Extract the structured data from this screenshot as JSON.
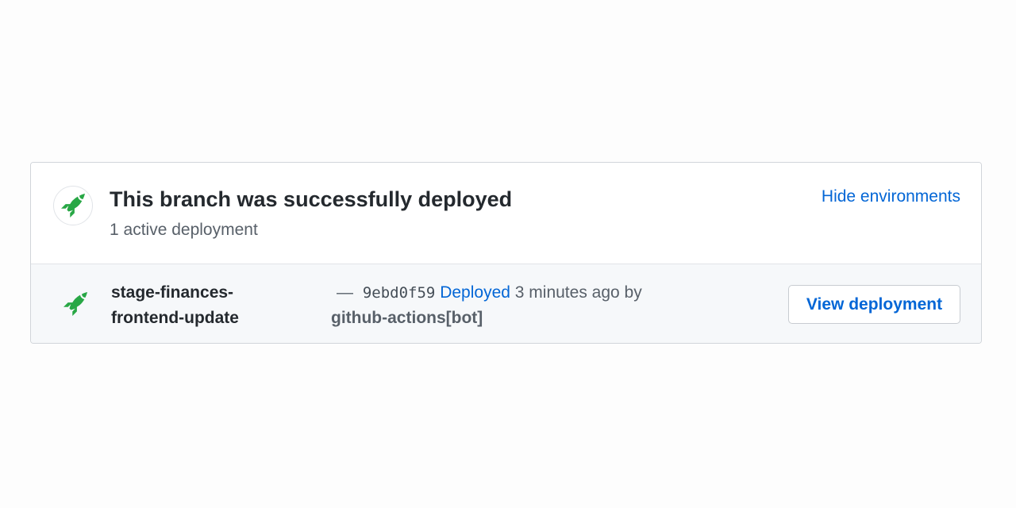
{
  "header": {
    "title": "This branch was successfully deployed",
    "subtitle": "1 active deployment",
    "hide_link": "Hide environments",
    "icon": "rocket-icon"
  },
  "deployment": {
    "environment": "stage-finances-\nfrontend-update",
    "dash": "—",
    "sha": "9ebd0f59",
    "status_link": "Deployed",
    "time_text": "3 minutes ago by",
    "actor": "github-actions[bot]",
    "view_button": "View deployment",
    "icon": "rocket-icon"
  },
  "colors": {
    "rocket": "#28a745",
    "link": "#0366d6",
    "text": "#24292e",
    "muted": "#586069"
  }
}
